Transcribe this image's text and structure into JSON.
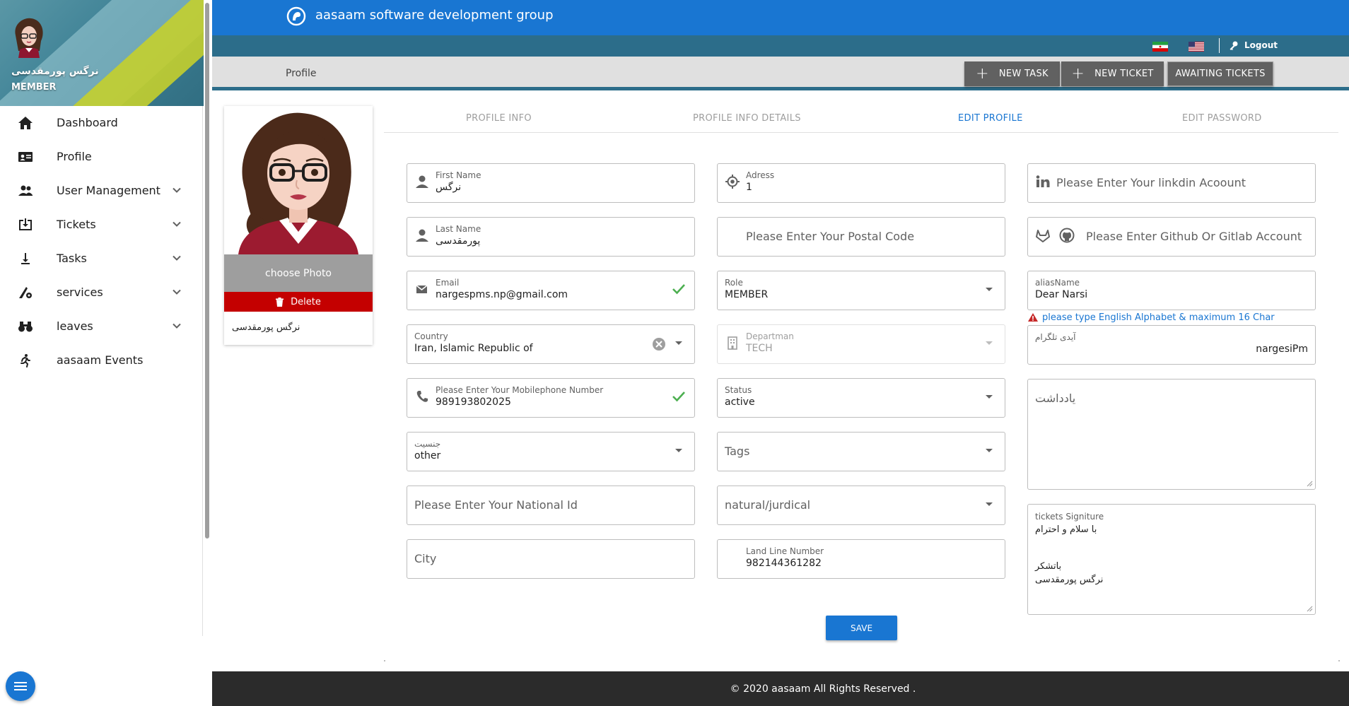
{
  "sidebar": {
    "user_name": "نرگس پورمقدسی",
    "user_role": "MEMBER",
    "items": [
      {
        "label": "Dashboard",
        "icon": "home-icon",
        "expandable": false
      },
      {
        "label": "Profile",
        "icon": "id-card-icon",
        "expandable": false
      },
      {
        "label": "User Management",
        "icon": "users-icon",
        "expandable": true
      },
      {
        "label": "Tickets",
        "icon": "ticket-inbox-icon",
        "expandable": true
      },
      {
        "label": "Tasks",
        "icon": "download-arrow-icon",
        "expandable": true
      },
      {
        "label": "services",
        "icon": "services-gear-icon",
        "expandable": true
      },
      {
        "label": "leaves",
        "icon": "binoculars-icon",
        "expandable": true
      },
      {
        "label": "aasaam Events",
        "icon": "running-person-icon",
        "expandable": false
      }
    ]
  },
  "header": {
    "brand": "aasaam software development group",
    "logout": "Logout",
    "page_title": "Profile",
    "buttons": {
      "new_task": "NEW TASK",
      "new_ticket": "NEW TICKET",
      "awaiting": "AWAITING TICKETS"
    }
  },
  "profile_card": {
    "choose_photo": "choose Photo",
    "delete": "Delete",
    "name": "نرگس   پورمقدسی"
  },
  "tabs": [
    "PROFILE INFO",
    "PROFILE INFO DETAILS",
    "EDIT PROFILE",
    "EDIT PASSWORD"
  ],
  "active_tab": "EDIT PROFILE",
  "form": {
    "first_name": {
      "label": "First Name",
      "value": "نرگس"
    },
    "last_name": {
      "label": "Last Name",
      "value": "پورمقدسی"
    },
    "email": {
      "label": "Email",
      "value": "nargespms.np@gmail.com"
    },
    "country": {
      "label": "Country",
      "value": "Iran, Islamic Republic of"
    },
    "mobile": {
      "label": "Please Enter Your Mobilephone Number",
      "value": "989193802025"
    },
    "gender": {
      "label": "جنسیت",
      "value": "other"
    },
    "national_id": {
      "placeholder": "Please Enter Your National Id"
    },
    "city": {
      "placeholder": "City"
    },
    "address": {
      "label": "Adress",
      "value": "1"
    },
    "postal_code": {
      "placeholder": "Please Enter Your Postal Code"
    },
    "role": {
      "label": "Role",
      "value": "MEMBER"
    },
    "department": {
      "label": "Departman",
      "value": "TECH"
    },
    "status": {
      "label": "Status",
      "value": "active"
    },
    "tags": {
      "placeholder": "Tags"
    },
    "entity_type": {
      "placeholder": "natural/jurdical"
    },
    "landline": {
      "label": "Land Line Number",
      "value": "982144361282"
    },
    "linkedin": {
      "placeholder": "Please Enter Your linkdin Acoount"
    },
    "github": {
      "placeholder": "Please Enter Github Or Gitlab Account"
    },
    "alias": {
      "label": "aliasName",
      "value": "Dear Narsi",
      "hint": "please type English Alphabet & maximum 16 Char"
    },
    "telegram": {
      "label": "آیدی تلگرام",
      "value": "nargesiPm"
    },
    "note": {
      "placeholder": "یادداشت"
    },
    "signature": {
      "label": "tickets Signiture",
      "line1": "با سلام و احترام",
      "line2": "باتشکر",
      "line3": "نرگس پورمقدسی"
    },
    "save": "SAVE"
  },
  "footer": "© 2020 aasaam All Rights Reserved .",
  "colors": {
    "primary": "#1976d2",
    "subbar": "#2c6d8a",
    "delete": "#c40000",
    "success": "#4caf50",
    "footer": "#2b2b2b"
  }
}
